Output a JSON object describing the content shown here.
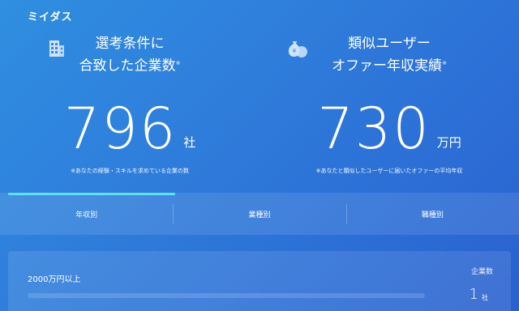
{
  "app": {
    "logo": "ミイダス"
  },
  "stats": [
    {
      "icon": "building-icon",
      "title_line1": "選考条件に",
      "title_line2": "合致した企業数",
      "mark": "※",
      "value": "796",
      "unit": "社",
      "note": "※あなたの経験・スキルを求めている企業の数"
    },
    {
      "icon": "money-bag-icon",
      "title_line1": "類似ユーザー",
      "title_line2": "オファー年収実績",
      "mark": "※",
      "value": "730",
      "unit": "万円",
      "note": "※あなたと類似したユーザーに届いたオファーの平均年収"
    }
  ],
  "tabs": [
    {
      "label": "年収別",
      "active": true
    },
    {
      "label": "業種別",
      "active": false
    },
    {
      "label": "職種別",
      "active": false
    }
  ],
  "table": {
    "column_header": "企業数",
    "rows": [
      {
        "label": "2000万円以上",
        "count": "1",
        "unit": "社"
      }
    ]
  },
  "colors": {
    "accent": "#5fe0f5",
    "background": "#2f7fdc"
  }
}
